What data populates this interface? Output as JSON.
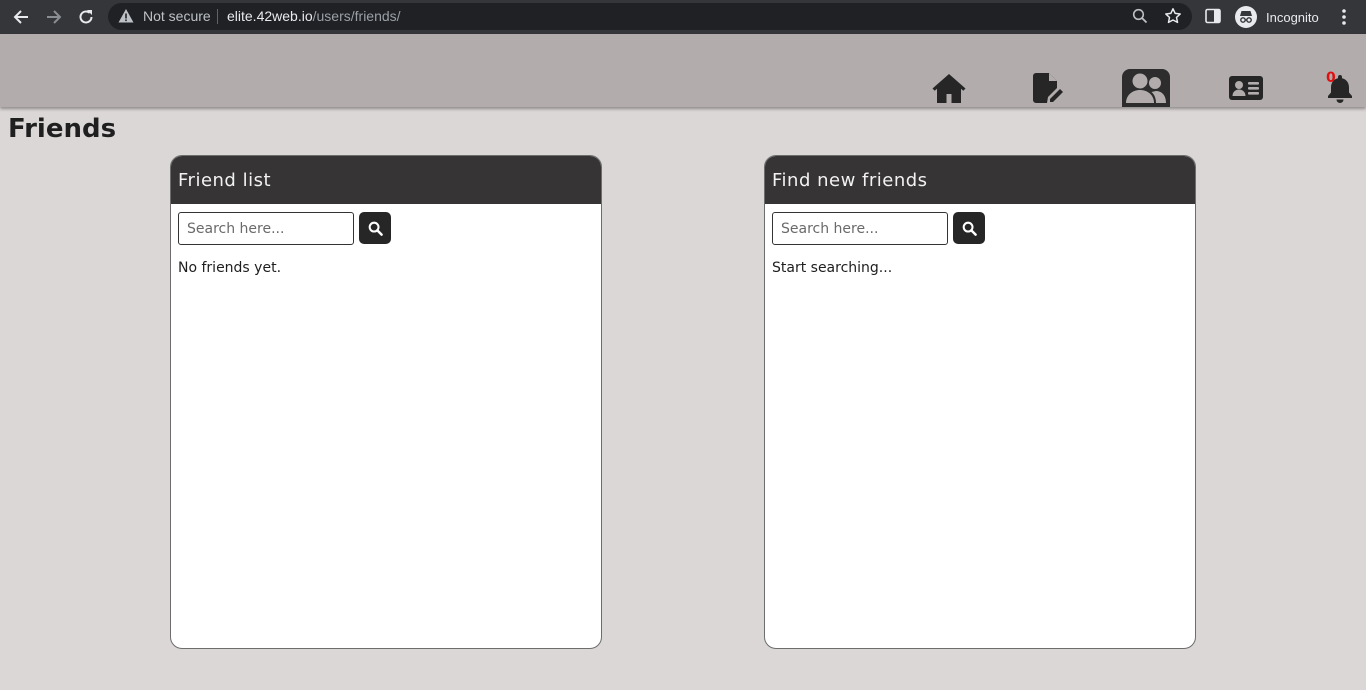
{
  "browser": {
    "security_label": "Not secure",
    "url_host": "elite.42web.io",
    "url_path": "/users/friends/",
    "profile_label": "Incognito"
  },
  "nav": {
    "items": [
      {
        "name": "home",
        "icon": "home-icon"
      },
      {
        "name": "posts",
        "icon": "file-pen-icon"
      },
      {
        "name": "friends",
        "icon": "user-group-icon",
        "active": true
      },
      {
        "name": "profile",
        "icon": "id-card-icon"
      },
      {
        "name": "notifications",
        "icon": "bell-icon"
      }
    ],
    "notification_count": "0",
    "badge_color": "#e01010"
  },
  "page": {
    "title": "Friends"
  },
  "friend_list": {
    "title": "Friend list",
    "search_placeholder": "Search here...",
    "message": "No friends yet."
  },
  "find_friends": {
    "title": "Find new friends",
    "search_placeholder": "Search here...",
    "message": "Start searching..."
  },
  "colors": {
    "page_bg": "#dcd7d7",
    "header_bg": "#b2adac",
    "panel_head_bg": "#363434",
    "accent_dark": "#262626"
  }
}
